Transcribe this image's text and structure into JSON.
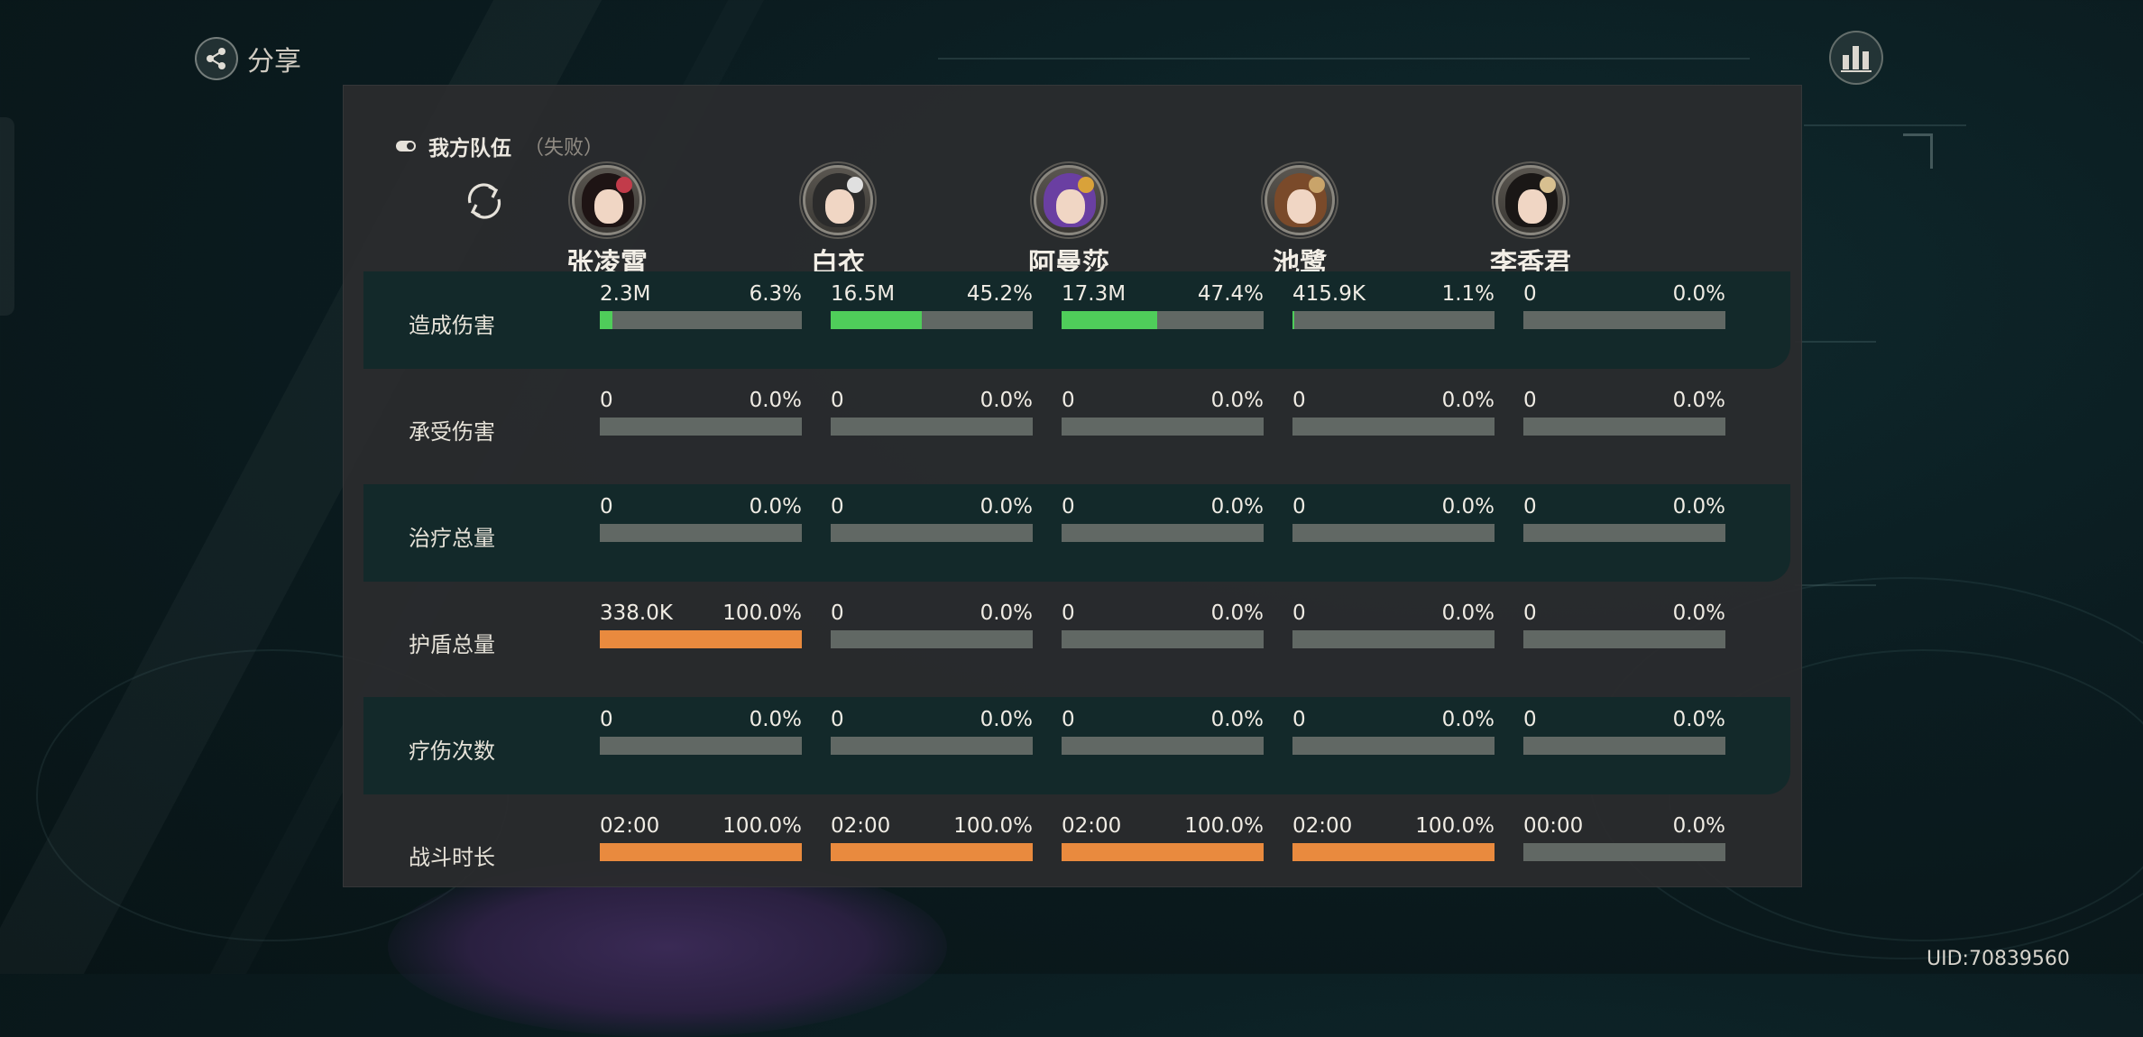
{
  "header": {
    "share_label": "分享"
  },
  "uid": "UID:70839560",
  "team": {
    "label": "我方队伍",
    "result": "（失败）"
  },
  "characters": [
    {
      "name": "张凌霄",
      "hair_color": "#1e1414",
      "accent_color": "#c23b4a"
    },
    {
      "name": "白衣",
      "hair_color": "#2b2b2b",
      "accent_color": "#e0e0e0"
    },
    {
      "name": "阿曼莎",
      "hair_color": "#6a3fa2",
      "accent_color": "#d9a23a"
    },
    {
      "name": "池鹭",
      "hair_color": "#7a4a2a",
      "accent_color": "#c9a46a"
    },
    {
      "name": "李香君",
      "hair_color": "#1a1716",
      "accent_color": "#d8c090"
    }
  ],
  "rows": [
    {
      "label": "造成伤害",
      "highlight": true,
      "bar_color": "green",
      "cells": [
        {
          "value": "2.3M",
          "percent": "6.3%",
          "fill": 6.3
        },
        {
          "value": "16.5M",
          "percent": "45.2%",
          "fill": 45.2
        },
        {
          "value": "17.3M",
          "percent": "47.4%",
          "fill": 47.4
        },
        {
          "value": "415.9K",
          "percent": "1.1%",
          "fill": 1.1
        },
        {
          "value": "0",
          "percent": "0.0%",
          "fill": 0
        }
      ]
    },
    {
      "label": "承受伤害",
      "highlight": false,
      "bar_color": "green",
      "cells": [
        {
          "value": "0",
          "percent": "0.0%",
          "fill": 0
        },
        {
          "value": "0",
          "percent": "0.0%",
          "fill": 0
        },
        {
          "value": "0",
          "percent": "0.0%",
          "fill": 0
        },
        {
          "value": "0",
          "percent": "0.0%",
          "fill": 0
        },
        {
          "value": "0",
          "percent": "0.0%",
          "fill": 0
        }
      ]
    },
    {
      "label": "治疗总量",
      "highlight": true,
      "bar_color": "green",
      "cells": [
        {
          "value": "0",
          "percent": "0.0%",
          "fill": 0
        },
        {
          "value": "0",
          "percent": "0.0%",
          "fill": 0
        },
        {
          "value": "0",
          "percent": "0.0%",
          "fill": 0
        },
        {
          "value": "0",
          "percent": "0.0%",
          "fill": 0
        },
        {
          "value": "0",
          "percent": "0.0%",
          "fill": 0
        }
      ]
    },
    {
      "label": "护盾总量",
      "highlight": false,
      "bar_color": "orange",
      "cells": [
        {
          "value": "338.0K",
          "percent": "100.0%",
          "fill": 100
        },
        {
          "value": "0",
          "percent": "0.0%",
          "fill": 0
        },
        {
          "value": "0",
          "percent": "0.0%",
          "fill": 0
        },
        {
          "value": "0",
          "percent": "0.0%",
          "fill": 0
        },
        {
          "value": "0",
          "percent": "0.0%",
          "fill": 0
        }
      ]
    },
    {
      "label": "疗伤次数",
      "highlight": true,
      "bar_color": "green",
      "cells": [
        {
          "value": "0",
          "percent": "0.0%",
          "fill": 0
        },
        {
          "value": "0",
          "percent": "0.0%",
          "fill": 0
        },
        {
          "value": "0",
          "percent": "0.0%",
          "fill": 0
        },
        {
          "value": "0",
          "percent": "0.0%",
          "fill": 0
        },
        {
          "value": "0",
          "percent": "0.0%",
          "fill": 0
        }
      ]
    },
    {
      "label": "战斗时长",
      "highlight": false,
      "bar_color": "orange",
      "cells": [
        {
          "value": "02:00",
          "percent": "100.0%",
          "fill": 100
        },
        {
          "value": "02:00",
          "percent": "100.0%",
          "fill": 100
        },
        {
          "value": "02:00",
          "percent": "100.0%",
          "fill": 100
        },
        {
          "value": "02:00",
          "percent": "100.0%",
          "fill": 100
        },
        {
          "value": "00:00",
          "percent": "0.0%",
          "fill": 0
        }
      ]
    }
  ]
}
